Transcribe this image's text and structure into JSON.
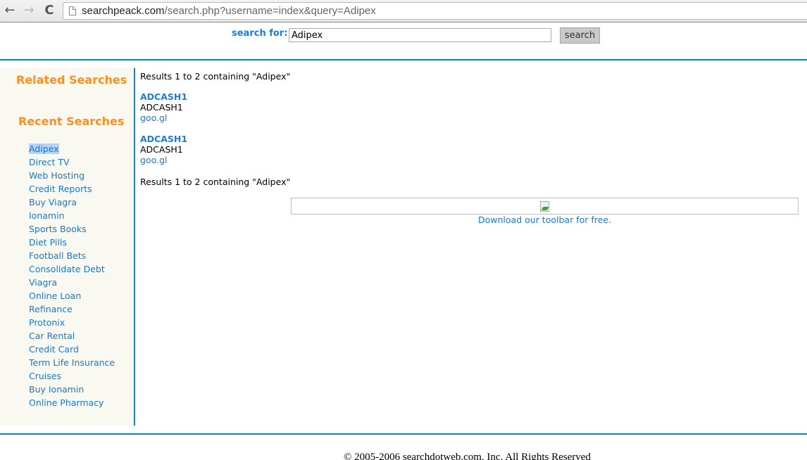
{
  "browser": {
    "url_domain": "searchpeack.com",
    "url_path": "/search.php?username=index&query=Adipex",
    "back_icon": "←",
    "forward_icon": "→",
    "reload_icon": "C"
  },
  "search": {
    "label": "search for:",
    "value": "Adipex",
    "button_label": "search"
  },
  "sidebar": {
    "related_heading": "Related Searches",
    "recent_heading": "Recent Searches",
    "recent_items": [
      {
        "label": "Adipex",
        "selected": true
      },
      {
        "label": "Direct TV"
      },
      {
        "label": "Web Hosting"
      },
      {
        "label": "Credit Reports"
      },
      {
        "label": "Buy Viagra"
      },
      {
        "label": "Ionamin"
      },
      {
        "label": "Sports Books"
      },
      {
        "label": "Diet Pills"
      },
      {
        "label": "Football Bets"
      },
      {
        "label": "Consolidate Debt"
      },
      {
        "label": "Viagra"
      },
      {
        "label": "Online Loan"
      },
      {
        "label": "Refinance"
      },
      {
        "label": "Protonix"
      },
      {
        "label": "Car Rental"
      },
      {
        "label": "Credit Card"
      },
      {
        "label": "Term Life Insurance"
      },
      {
        "label": "Cruises"
      },
      {
        "label": "Buy Ionamin"
      },
      {
        "label": "Online Pharmacy"
      }
    ]
  },
  "results": {
    "count_text": "Results 1 to 2 containing \"Adipex\"",
    "items": [
      {
        "title": "ADCASH1",
        "description": "ADCASH1",
        "link": "goo.gl"
      },
      {
        "title": "ADCASH1",
        "description": "ADCASH1",
        "link": "goo.gl"
      }
    ]
  },
  "promo": {
    "toolbar_link": "Download our toolbar for free."
  },
  "footer": {
    "copyright": "© 2005-2006 searchdotweb.com, Inc. All Rights Reserved"
  },
  "colors": {
    "accent_blue": "#0a82d2",
    "heading_orange": "#ff8e1c",
    "link_blue": "#1a78c8",
    "sidebar_bg": "#f9f8f1"
  }
}
